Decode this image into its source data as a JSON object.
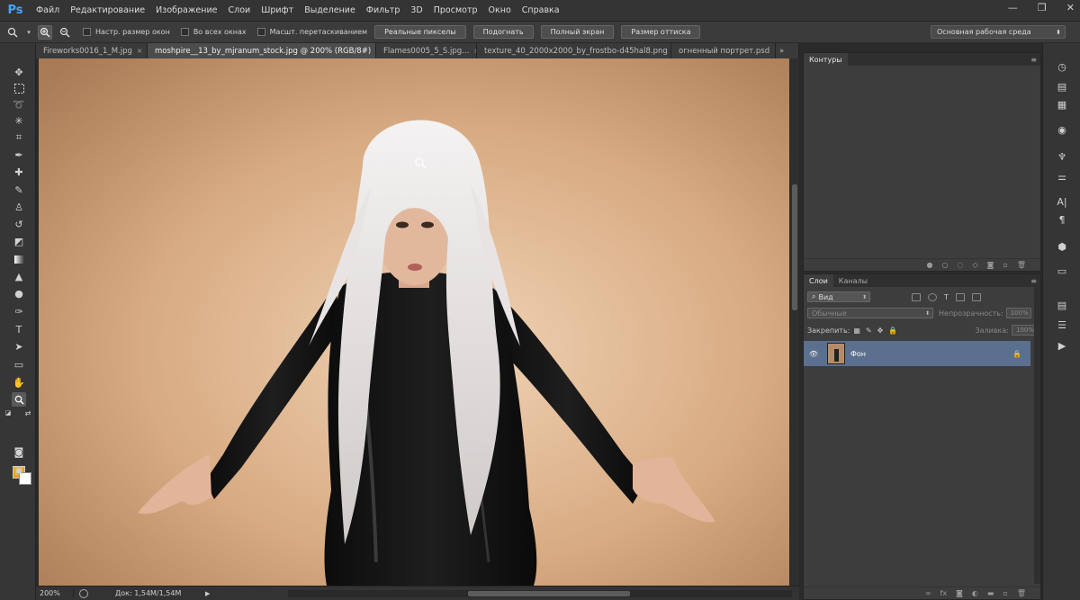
{
  "app": {
    "logo": "Ps"
  },
  "menu": [
    "Файл",
    "Редактирование",
    "Изображение",
    "Слои",
    "Шрифт",
    "Выделение",
    "Фильтр",
    "3D",
    "Просмотр",
    "Окно",
    "Справка"
  ],
  "window_controls": {
    "minimize": "—",
    "restore": "❐",
    "close": "✕"
  },
  "options": {
    "checkbox_resize": "Настр. размер окон",
    "checkbox_all_windows": "Во всех окнах",
    "checkbox_scrubby": "Масшт. перетаскиванием",
    "btn_actual": "Реальные пикселы",
    "btn_fit": "Подогнать",
    "btn_fill": "Полный экран",
    "btn_print": "Размер оттиска",
    "workspace": "Основная рабочая среда"
  },
  "tabs": [
    {
      "label": "Fireworks0016_1_M.jpg"
    },
    {
      "label": "moshpire__13_by_mjranum_stock.jpg @ 200% (RGB/8#)"
    },
    {
      "label": "Flames0005_5_S.jpg..."
    },
    {
      "label": "texture_40_2000x2000_by_frostbo-d45hal8.png"
    },
    {
      "label": "огненный портрет.psd"
    }
  ],
  "status": {
    "zoom": "200%",
    "doc": "Док: 1,54M/1,54M"
  },
  "panels": {
    "paths_title": "Контуры",
    "layers_tab": "Слои",
    "channels_tab": "Каналы",
    "kind_filter": "Вид",
    "blend_mode": "Обычные",
    "opacity_label": "Непрозрачность:",
    "opacity_value": "100%",
    "lock_label": "Закрепить:",
    "fill_label": "Заливка:",
    "fill_value": "100%",
    "layer_name": "Фон"
  },
  "colors": {
    "foreground": "#f0a000",
    "background": "#ffffff",
    "selected_layer": "#5b6f8f"
  }
}
